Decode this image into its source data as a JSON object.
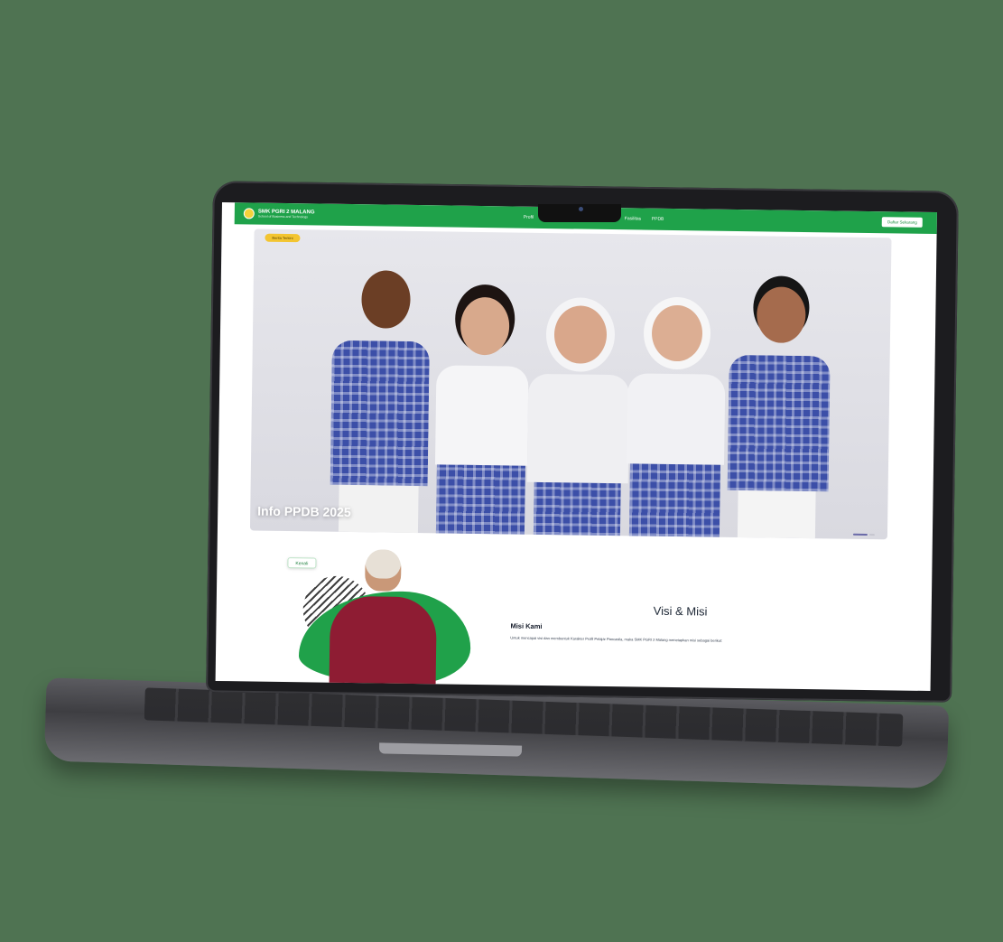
{
  "navbar": {
    "brand_name": "SMK PGRI 2 MALANG",
    "brand_tagline": "School of Business and Technology",
    "links": [
      "Profil",
      "Fasilitas",
      "PPDB"
    ],
    "cta_label": "Daftar Sekarang",
    "accent": "#1fa24a"
  },
  "hero": {
    "chip_label": "Berita Terkini",
    "caption": "Info PPDB 2025"
  },
  "section": {
    "greet_button": "Kenali",
    "visi_title": "Visi & Misi",
    "misi_title": "Misi Kami",
    "misi_text": "Untuk mencapai visi dan membentuk Karakter Profil Pelajar Pancasila, maka SMK PGRI 2 Malang menetapkan misi sebagai berikut:"
  }
}
